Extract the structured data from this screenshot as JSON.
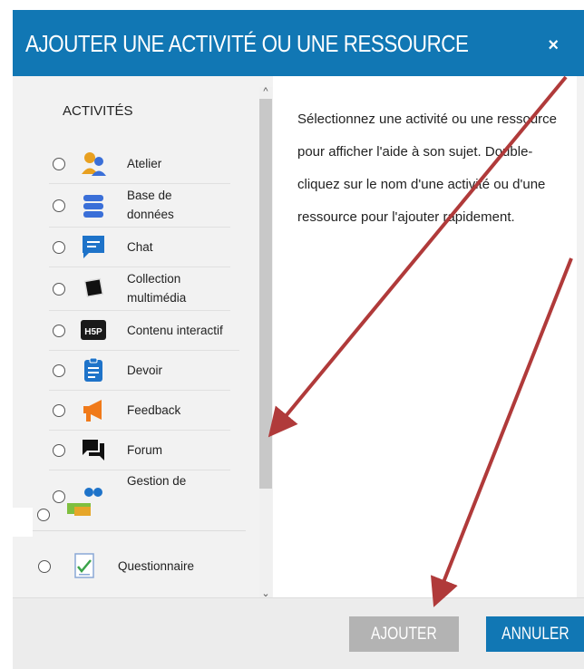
{
  "dialog": {
    "title": "AJOUTER UNE ACTIVITÉ OU UNE RESSOURCE",
    "close_icon": "×"
  },
  "activities": {
    "heading": "ACTIVITÉS",
    "items": [
      {
        "label": "Atelier",
        "icon": "atelier-icon"
      },
      {
        "label": "Base de\ndonnées",
        "icon": "database-icon"
      },
      {
        "label": "Chat",
        "icon": "chat-icon"
      },
      {
        "label": "Collection\nmultimédia",
        "icon": "lightbox-gallery-icon"
      },
      {
        "label": "Contenu interactif",
        "icon": "h5p-icon"
      },
      {
        "label": "Devoir",
        "icon": "assignment-icon"
      },
      {
        "label": "Feedback",
        "icon": "megaphone-icon"
      },
      {
        "label": "Forum",
        "icon": "forum-icon"
      },
      {
        "label": "Gestion de",
        "icon": "attendance-icon"
      },
      {
        "label": "Questionnaire",
        "icon": "questionnaire-icon"
      }
    ]
  },
  "help": {
    "text": "Sélectionnez une activité ou une ressource pour afficher l'aide à son sujet. Double-cliquez sur le nom d'une activité ou d'une ressource pour l'ajouter rapidement."
  },
  "footer": {
    "add_label": "AJOUTER",
    "cancel_label": "ANNULER"
  },
  "colors": {
    "accent": "#1177b4",
    "annotation_arrow": "#b03a3a"
  }
}
